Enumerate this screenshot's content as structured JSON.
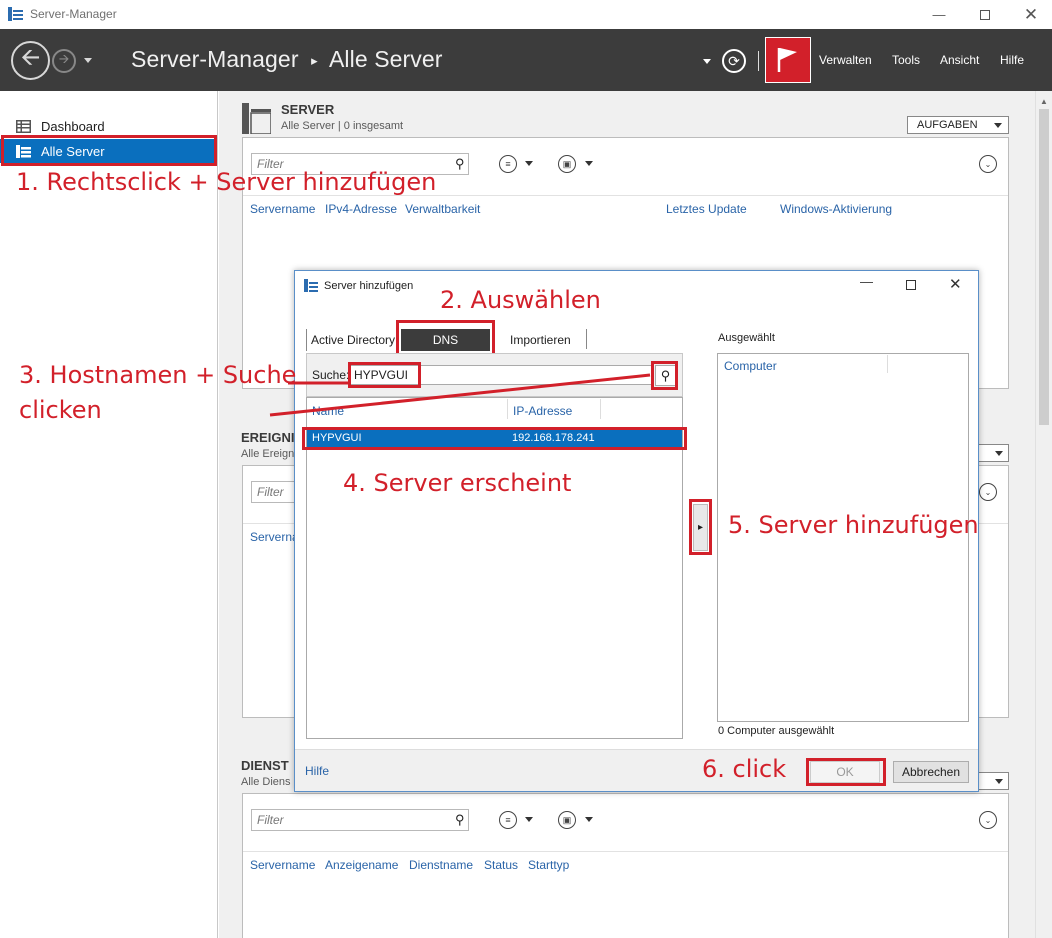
{
  "window": {
    "title": "Server-Manager"
  },
  "header": {
    "breadcrumb_root": "Server-Manager",
    "breadcrumb_separator": "▸",
    "breadcrumb_current": "Alle Server",
    "menu": [
      "Verwalten",
      "Tools",
      "Ansicht",
      "Hilfe"
    ]
  },
  "sidebar": {
    "items": [
      {
        "label": "Dashboard",
        "icon": "dashboard-icon"
      },
      {
        "label": "Alle Server",
        "icon": "servers-icon",
        "selected": true
      }
    ]
  },
  "server_section": {
    "title": "SERVER",
    "subtitle": "Alle Server | 0 insgesamt",
    "tasks_label": "AUFGABEN",
    "filter_placeholder": "Filter",
    "columns": [
      "Servername",
      "IPv4-Adresse",
      "Verwaltbarkeit",
      "Letztes Update",
      "Windows-Aktivierung"
    ]
  },
  "events_section": {
    "title": "EREIGNI",
    "subtitle": "Alle Ereign",
    "filter_placeholder": "Filter",
    "columns": [
      "Serverna"
    ]
  },
  "services_section": {
    "title": "DIENST",
    "subtitle": "Alle Diens",
    "filter_placeholder": "Filter",
    "columns": [
      "Servername",
      "Anzeigename",
      "Dienstname",
      "Status",
      "Starttyp"
    ]
  },
  "dialog": {
    "title": "Server hinzufügen",
    "tabs": [
      "Active Directory",
      "DNS",
      "Importieren"
    ],
    "search_label": "Suche:",
    "search_value": "HYPVGUI",
    "results_columns": [
      "Name",
      "IP-Adresse"
    ],
    "results": [
      {
        "name": "HYPVGUI",
        "ip": "192.168.178.241"
      }
    ],
    "selected_label": "Ausgewählt",
    "selected_column": "Computer",
    "selected_count": "0 Computer ausgewählt",
    "help_link": "Hilfe",
    "ok_label": "OK",
    "cancel_label": "Abbrechen",
    "add_arrow": "▸"
  },
  "annotations": {
    "step1": "1. Rechtsclick + Server hinzufügen",
    "step2": "2. Auswählen",
    "step3_line1": "3. Hostnamen + Suche",
    "step3_line2": "clicken",
    "step4": "4. Server erscheint",
    "step5": "5. Server hinzufügen",
    "step6": "6. click"
  },
  "colors": {
    "accent_red": "#d2202a",
    "selection_blue": "#0a6fbe",
    "header_bg": "#3c3c3c",
    "link_blue": "#2a64a8"
  }
}
